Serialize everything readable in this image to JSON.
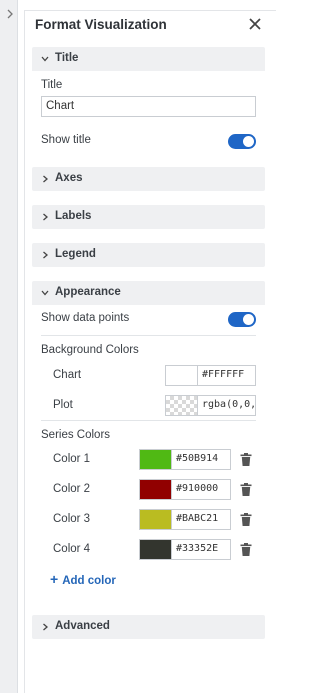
{
  "panel": {
    "title": "Format Visualization"
  },
  "sections": {
    "title": {
      "label": "Title",
      "field_label": "Title",
      "field_value": "Chart",
      "show_title_label": "Show title",
      "show_title_on": true
    },
    "axes": {
      "label": "Axes"
    },
    "labels": {
      "label": "Labels"
    },
    "legend": {
      "label": "Legend"
    },
    "appearance": {
      "label": "Appearance",
      "show_points_label": "Show data points",
      "show_points_on": true,
      "background_colors_label": "Background Colors",
      "chart_label": "Chart",
      "chart_value": "#FFFFFF",
      "plot_label": "Plot",
      "plot_value": "rgba(0,0,",
      "series_colors_label": "Series Colors",
      "series": [
        {
          "label": "Color 1",
          "value": "#50B914",
          "color": "#50B914"
        },
        {
          "label": "Color 2",
          "value": "#910000",
          "color": "#910000"
        },
        {
          "label": "Color 3",
          "value": "#BABC21",
          "color": "#BABC21"
        },
        {
          "label": "Color 4",
          "value": "#33352E",
          "color": "#33352E"
        }
      ],
      "add_color_label": "Add color"
    },
    "advanced": {
      "label": "Advanced"
    }
  },
  "icons": {
    "close": "close-icon",
    "collapse": "chevron-right-icon",
    "expanded": "chevron-down-icon",
    "collapsed": "chevron-right-icon",
    "delete": "trash-icon",
    "add": "plus-icon"
  },
  "colors": {
    "accent": "#1F66C6",
    "link": "#2466B8",
    "section_bg": "#EFF0F2"
  }
}
